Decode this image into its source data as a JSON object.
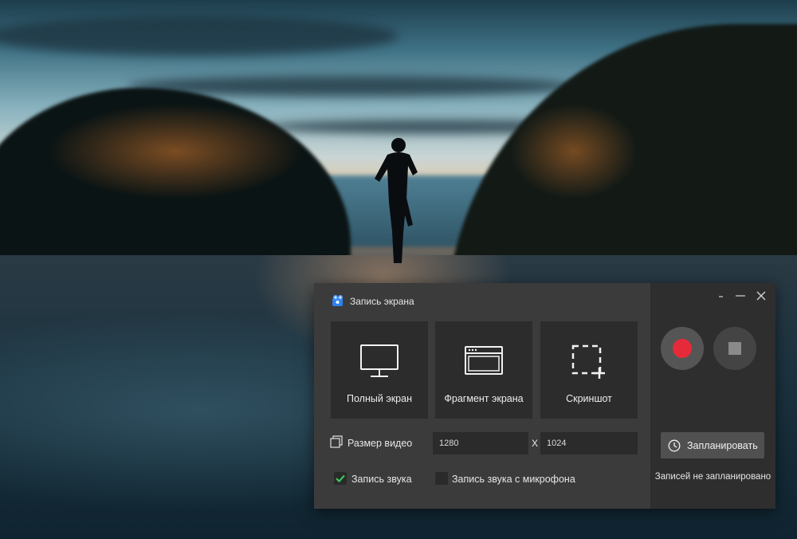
{
  "window": {
    "title": "Запись экрана"
  },
  "modes": [
    {
      "label": "Полный экран",
      "icon": "monitor-icon"
    },
    {
      "label": "Фрагмент экрана",
      "icon": "browser-window-icon"
    },
    {
      "label": "Скриншот",
      "icon": "selection-crop-icon"
    }
  ],
  "video_size": {
    "label": "Размер видео",
    "width": "1280",
    "separator": "X",
    "height": "1024"
  },
  "audio": {
    "system_label": "Запись звука",
    "system_checked": true,
    "mic_label": "Запись звука с микрофона",
    "mic_checked": false
  },
  "controls": {
    "minimize_glyph": "-",
    "maximize_glyph": "—",
    "close_glyph": "✕",
    "record_icon": "record-icon",
    "stop_icon": "stop-icon"
  },
  "schedule": {
    "button_label": "Запланировать",
    "status": "Записей не запланировано"
  },
  "colors": {
    "record_red": "#e52b3a",
    "panel_bg": "#3b3b3b",
    "side_bg": "#2e2e2e",
    "tile_bg": "#2c2c2c",
    "check_green": "#3fc65a"
  }
}
